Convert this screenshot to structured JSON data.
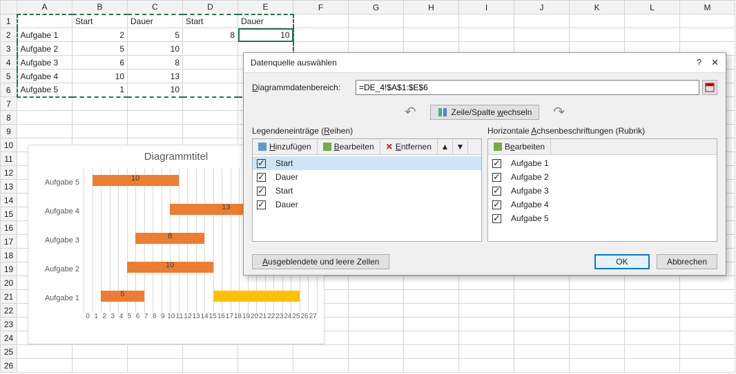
{
  "columns": [
    "A",
    "B",
    "C",
    "D",
    "E",
    "F",
    "G",
    "H",
    "I",
    "J",
    "K",
    "L",
    "M"
  ],
  "header_row": [
    "",
    "Start",
    "Dauer",
    "Start",
    "Dauer"
  ],
  "rows": [
    [
      "Aufgabe 1",
      "2",
      "5",
      "8",
      "10"
    ],
    [
      "Aufgabe 2",
      "5",
      "10",
      "",
      ""
    ],
    [
      "Aufgabe 3",
      "6",
      "8",
      "",
      ""
    ],
    [
      "Aufgabe 4",
      "10",
      "13",
      "",
      ""
    ],
    [
      "Aufgabe 5",
      "1",
      "10",
      "",
      ""
    ]
  ],
  "chart": {
    "title": "Diagrammtitel",
    "labels": [
      "Aufgabe 5",
      "Aufgabe 4",
      "Aufgabe 3",
      "Aufgabe 2",
      "Aufgabe 1"
    ],
    "ticks": [
      "0",
      "1",
      "2",
      "3",
      "4",
      "5",
      "6",
      "7",
      "8",
      "9",
      "10",
      "11",
      "12",
      "13",
      "14",
      "15",
      "16",
      "17",
      "18",
      "19",
      "20",
      "21",
      "22",
      "23",
      "24",
      "25",
      "26",
      "27"
    ]
  },
  "chart_data": {
    "type": "bar",
    "orientation": "horizontal",
    "stacked": true,
    "categories": [
      "Aufgabe 1",
      "Aufgabe 2",
      "Aufgabe 3",
      "Aufgabe 4",
      "Aufgabe 5"
    ],
    "series": [
      {
        "name": "Start",
        "values": [
          2,
          5,
          6,
          10,
          1
        ],
        "color": "transparent"
      },
      {
        "name": "Dauer",
        "values": [
          5,
          10,
          8,
          13,
          10
        ],
        "color": "#ed7d31"
      },
      {
        "name": "Start",
        "values": [
          8,
          null,
          null,
          null,
          null
        ],
        "color": "transparent"
      },
      {
        "name": "Dauer",
        "values": [
          10,
          null,
          null,
          null,
          null
        ],
        "color": "#ffc000"
      }
    ],
    "data_labels": {
      "Dauer": true
    },
    "title": "Diagrammtitel",
    "xlabel": "",
    "ylabel": "",
    "xlim": [
      0,
      27
    ]
  },
  "dialog": {
    "title": "Datenquelle auswählen",
    "range_label": "Diagrammdatenbereich:",
    "range_value": "=DE_4!$A$1:$E$6",
    "swap_label": "Zeile/Spalte wechseln",
    "series_title": "Legendeneinträge (Reihen)",
    "axis_title": "Horizontale Achsenbeschriftungen (Rubrik)",
    "btn_add": "Hinzufügen",
    "btn_edit": "Bearbeiten",
    "btn_remove": "Entfernen",
    "series_items": [
      "Start",
      "Dauer",
      "Start",
      "Dauer"
    ],
    "axis_items": [
      "Aufgabe 1",
      "Aufgabe 2",
      "Aufgabe 3",
      "Aufgabe 4",
      "Aufgabe 5"
    ],
    "hidden_btn": "Ausgeblendete und leere Zellen",
    "ok": "OK",
    "cancel": "Abbrechen"
  }
}
